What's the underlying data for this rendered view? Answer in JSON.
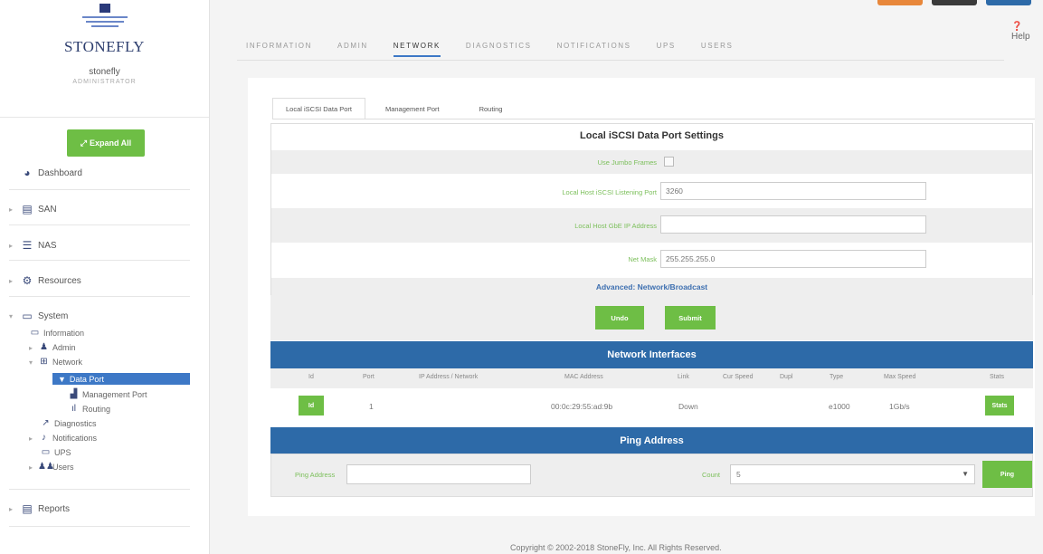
{
  "sidebar": {
    "brand": "STONEFLY",
    "username": "stonefly",
    "role": "ADMINISTRATOR",
    "expand_all": "Expand All",
    "items": {
      "dashboard": "Dashboard",
      "san": "SAN",
      "nas": "NAS",
      "resources": "Resources",
      "system": "System",
      "reports": "Reports"
    },
    "system_children": {
      "information": "Information",
      "admin": "Admin",
      "network": "Network",
      "data_port": "Data Port",
      "management_port": "Management Port",
      "routing": "Routing",
      "diagnostics": "Diagnostics",
      "notifications": "Notifications",
      "ups": "UPS",
      "users": "Users"
    }
  },
  "header": {
    "help": "Help",
    "tabs": [
      "INFORMATION",
      "ADMIN",
      "NETWORK",
      "DIAGNOSTICS",
      "NOTIFICATIONS",
      "UPS",
      "USERS"
    ],
    "active_tab": "NETWORK",
    "top_button_colors": [
      "#e8873a",
      "#3a3a3a",
      "#2d6aa8"
    ]
  },
  "subtabs": [
    "Local iSCSI Data Port",
    "Management Port",
    "Routing"
  ],
  "settings": {
    "title": "Local iSCSI Data Port Settings",
    "jumbo_label": "Use Jumbo Frames",
    "jumbo_checked": false,
    "listening_port_label": "Local Host iSCSI Listening Port",
    "listening_port_value": "3260",
    "gbe_ip_label": "Local Host GbE IP Address",
    "gbe_ip_value": "",
    "netmask_label": "Net Mask",
    "netmask_value": "255.255.255.0",
    "advanced": "Advanced: Network/Broadcast",
    "undo": "Undo",
    "submit": "Submit"
  },
  "network_interfaces": {
    "title": "Network Interfaces",
    "columns": [
      "Id",
      "Port",
      "IP Address / Network",
      "MAC Address",
      "Link",
      "Cur Speed",
      "Dupl",
      "Type",
      "Max Speed",
      "Stats"
    ],
    "rows": [
      {
        "id_btn": "Id",
        "port": "1",
        "ip": "",
        "mac": "00:0c:29:55:ad:9b",
        "link": "Down",
        "cur_speed": "",
        "dupl": "",
        "type": "e1000",
        "max_speed": "1Gb/s",
        "stats_btn": "Stats"
      }
    ]
  },
  "ping": {
    "title": "Ping Address",
    "address_label": "Ping Address",
    "address_value": "",
    "count_label": "Count",
    "count_value": "5",
    "button": "Ping"
  },
  "footer": "Copyright © 2002-2018 StoneFly, Inc. All Rights Reserved.",
  "colors": {
    "accent_green": "#6ebe45",
    "header_blue": "#2d6aa8",
    "active_nav": "#3d78c6"
  }
}
